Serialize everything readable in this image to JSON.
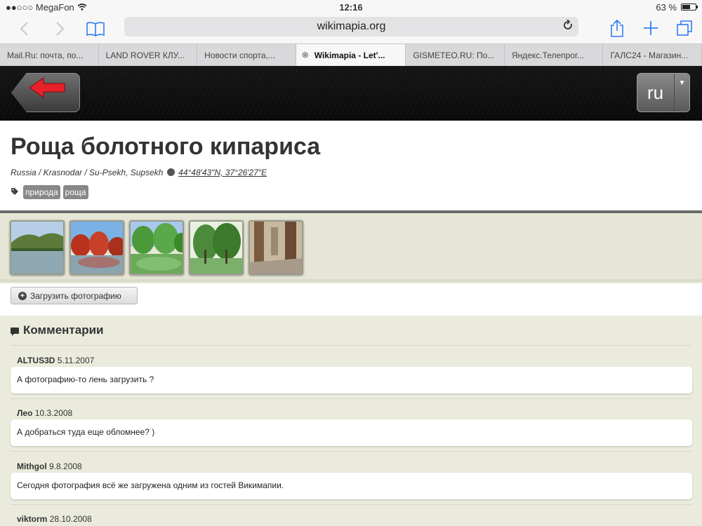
{
  "status_bar": {
    "carrier": "●●○○○ MegaFon",
    "time": "12:16",
    "battery": "63 %",
    "battery_level": 0.63
  },
  "toolbar": {
    "url": "wikimapia.org",
    "icons": {
      "back": "chevron-left-icon",
      "forward": "chevron-right-icon",
      "bookmarks": "book-icon",
      "reload": "reload-icon",
      "share": "share-icon",
      "new_tab": "plus-icon",
      "tabs": "tabs-icon"
    }
  },
  "tabs": [
    {
      "label": "Mail.Ru: почта, по..."
    },
    {
      "label": "LAND ROVER КЛУ..."
    },
    {
      "label": "Новости спорта,..."
    },
    {
      "label": "Wikimapia - Let'...",
      "active": true
    },
    {
      "label": "GISMETEO.RU: По..."
    },
    {
      "label": "Яндекс.Телепрог..."
    },
    {
      "label": "ГАЛС24 - Магазин..."
    }
  ],
  "header": {
    "lang": "ru"
  },
  "place": {
    "title": "Роща болотного кипариса",
    "breadcrumb": "Russia / Krasnodar / Su-Psekh, Supsekh",
    "coords": "44°48′43″N, 37°26′27″E",
    "tags": [
      "природа",
      "роща"
    ]
  },
  "photos": [
    {
      "name": "photo-1"
    },
    {
      "name": "photo-2"
    },
    {
      "name": "photo-3"
    },
    {
      "name": "photo-4"
    },
    {
      "name": "photo-5"
    }
  ],
  "upload": {
    "label": "Загрузить фотографию"
  },
  "comments": {
    "title": "Комментарии",
    "items": [
      {
        "author": "ALTUS3D",
        "date": "5.11.2007",
        "text": "А фотографию-то лень загрузить ?"
      },
      {
        "author": "Лео",
        "date": "10.3.2008",
        "text": "А добраться туда еще обломнее? )"
      },
      {
        "author": "Mithgol",
        "date": "9.8.2008",
        "text": "Сегодня фотография всё же загружена одним из гостей Викимапии."
      },
      {
        "author": "viktorm",
        "date": "28.10.2008",
        "text": ""
      }
    ]
  },
  "colors": {
    "accent_blue": "#2f7cf6",
    "arrow_red": "#e8202a",
    "comments_bg": "#ebebdd"
  }
}
